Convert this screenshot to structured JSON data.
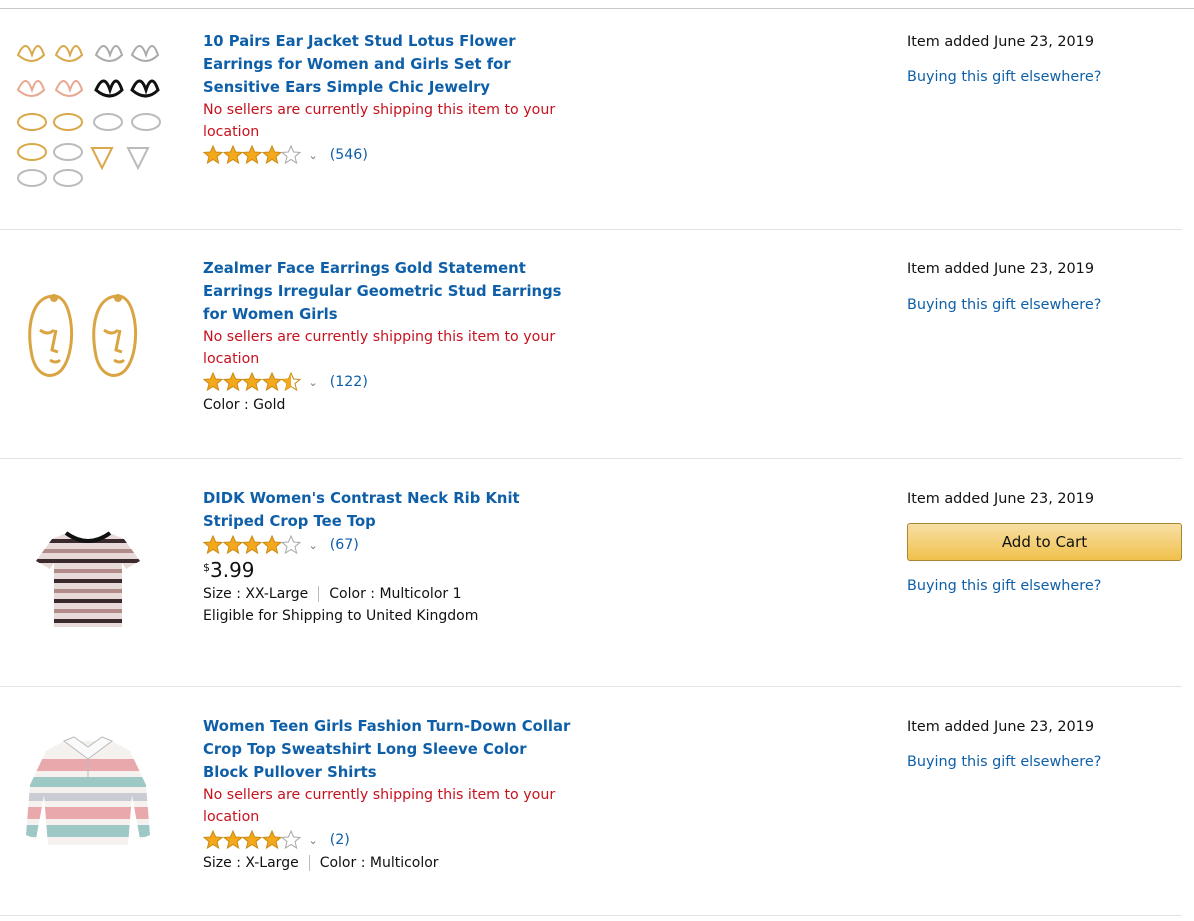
{
  "items": [
    {
      "title": "10 Pairs Ear Jacket Stud Lotus Flower Earrings for Women and Girls Set for Sensitive Ears Simple Chic Jewelry",
      "warning": "No sellers are currently shipping this item to your location",
      "rating": 4,
      "review_count": "(546)",
      "added": "Item added June 23, 2019",
      "buying_link": "Buying this gift elsewhere?"
    },
    {
      "title": "Zealmer Face Earrings Gold Statement Earrings Irregular Geometric Stud Earrings for Women Girls",
      "warning": "No sellers are currently shipping this item to your location",
      "rating": 4.5,
      "review_count": "(122)",
      "color": "Color : Gold",
      "added": "Item added June 23, 2019",
      "buying_link": "Buying this gift elsewhere?"
    },
    {
      "title": "DIDK Women's Contrast Neck Rib Knit Striped Crop Tee Top",
      "rating": 4,
      "review_count": "(67)",
      "price_symbol": "$",
      "price": "3.99",
      "size": "Size : XX-Large",
      "color": "Color : Multicolor 1",
      "shipping": "Eligible for Shipping to United Kingdom",
      "added": "Item added June 23, 2019",
      "cart_label": "Add to Cart",
      "buying_link": "Buying this gift elsewhere?"
    },
    {
      "title": "Women Teen Girls Fashion Turn-Down Collar Crop Top Sweatshirt Long Sleeve Color Block Pullover Shirts",
      "warning": "No sellers are currently shipping this item to your location",
      "rating": 4,
      "review_count": "(2)",
      "size": "Size : X-Large",
      "color": "Color : Multicolor",
      "added": "Item added June 23, 2019",
      "buying_link": "Buying this gift elsewhere?"
    }
  ],
  "colors": {
    "link": "#0e5fa8",
    "warning": "#c7111e",
    "star": "#f4a81c",
    "cart_button": "#f0c14b"
  },
  "icons": {
    "star": "star-icon",
    "half_star": "half-star-icon",
    "empty_star": "empty-star-icon",
    "chevron": "chevron-down-icon"
  }
}
